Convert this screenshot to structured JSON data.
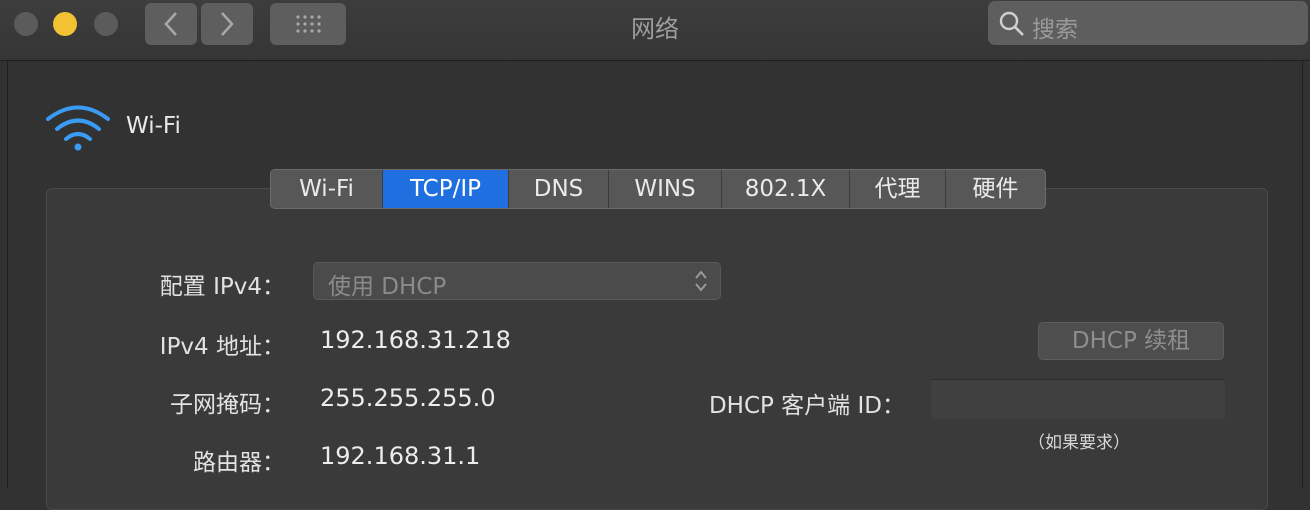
{
  "window": {
    "title": "网络",
    "search_placeholder": "搜索"
  },
  "interface": {
    "name": "Wi-Fi",
    "icon": "wifi-icon",
    "icon_color": "#3a9bf4"
  },
  "tabs": [
    {
      "label": "Wi-Fi",
      "active": false
    },
    {
      "label": "TCP/IP",
      "active": true
    },
    {
      "label": "DNS",
      "active": false
    },
    {
      "label": "WINS",
      "active": false
    },
    {
      "label": "802.1X",
      "active": false
    },
    {
      "label": "代理",
      "active": false
    },
    {
      "label": "硬件",
      "active": false
    }
  ],
  "form": {
    "configure_ipv4_label": "配置 IPv4：",
    "configure_ipv4_value": "使用 DHCP",
    "ipv4_address_label": "IPv4 地址：",
    "ipv4_address_value": "192.168.31.218",
    "subnet_mask_label": "子网掩码：",
    "subnet_mask_value": "255.255.255.0",
    "router_label": "路由器：",
    "router_value": "192.168.31.1",
    "renew_button": "DHCP 续租",
    "client_id_label": "DHCP 客户端 ID：",
    "client_id_value": "",
    "client_id_hint": "（如果要求）"
  },
  "colors": {
    "accent": "#1f6fe0",
    "minimize_light": "#f2c232"
  }
}
